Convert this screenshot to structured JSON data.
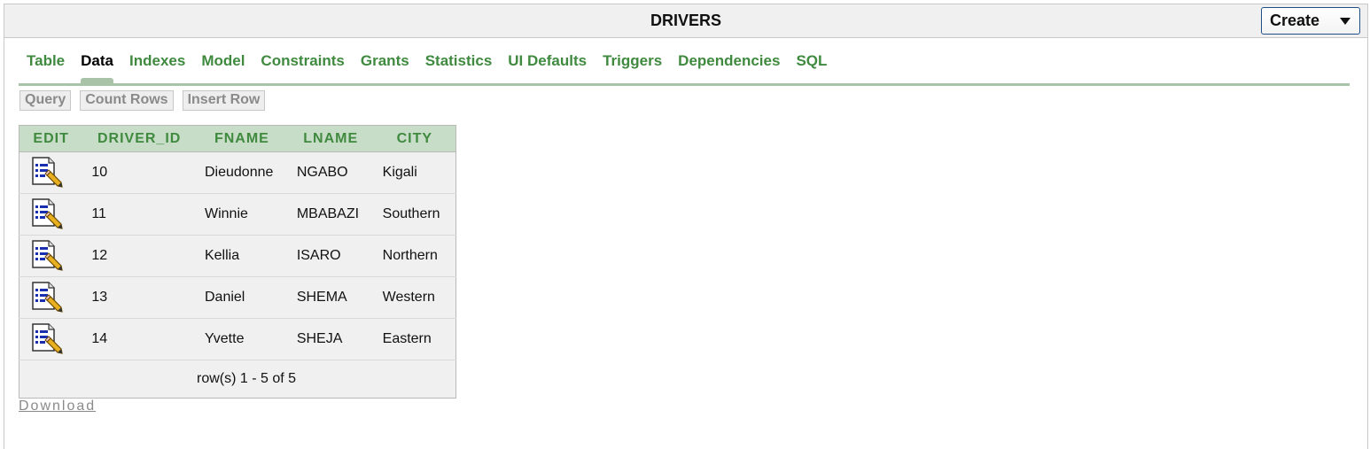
{
  "header": {
    "title": "DRIVERS",
    "create_label": "Create"
  },
  "tabs": [
    {
      "label": "Table"
    },
    {
      "label": "Data",
      "active": true
    },
    {
      "label": "Indexes"
    },
    {
      "label": "Model"
    },
    {
      "label": "Constraints"
    },
    {
      "label": "Grants"
    },
    {
      "label": "Statistics"
    },
    {
      "label": "UI Defaults"
    },
    {
      "label": "Triggers"
    },
    {
      "label": "Dependencies"
    },
    {
      "label": "SQL"
    }
  ],
  "actions": {
    "query": "Query",
    "count_rows": "Count Rows",
    "insert_row": "Insert Row"
  },
  "table": {
    "columns": [
      "EDIT",
      "DRIVER_ID",
      "FNAME",
      "LNAME",
      "CITY"
    ],
    "rows": [
      {
        "driver_id": "10",
        "fname": "Dieudonne",
        "lname": "NGABO",
        "city": "Kigali"
      },
      {
        "driver_id": "11",
        "fname": "Winnie",
        "lname": "MBABAZI",
        "city": "Southern"
      },
      {
        "driver_id": "12",
        "fname": "Kellia",
        "lname": "ISARO",
        "city": "Northern"
      },
      {
        "driver_id": "13",
        "fname": "Daniel",
        "lname": "SHEMA",
        "city": "Western"
      },
      {
        "driver_id": "14",
        "fname": "Yvette",
        "lname": "SHEJA",
        "city": "Eastern"
      }
    ],
    "footer": "row(s) 1 - 5 of 5",
    "edit_icon": "edit-record-icon"
  },
  "download_label": "Download",
  "colors": {
    "tab_green": "#3f8a3f",
    "header_bg": "#c8ddc8",
    "tab_underline": "#a9c3a9",
    "button_border": "#1f4f86"
  }
}
